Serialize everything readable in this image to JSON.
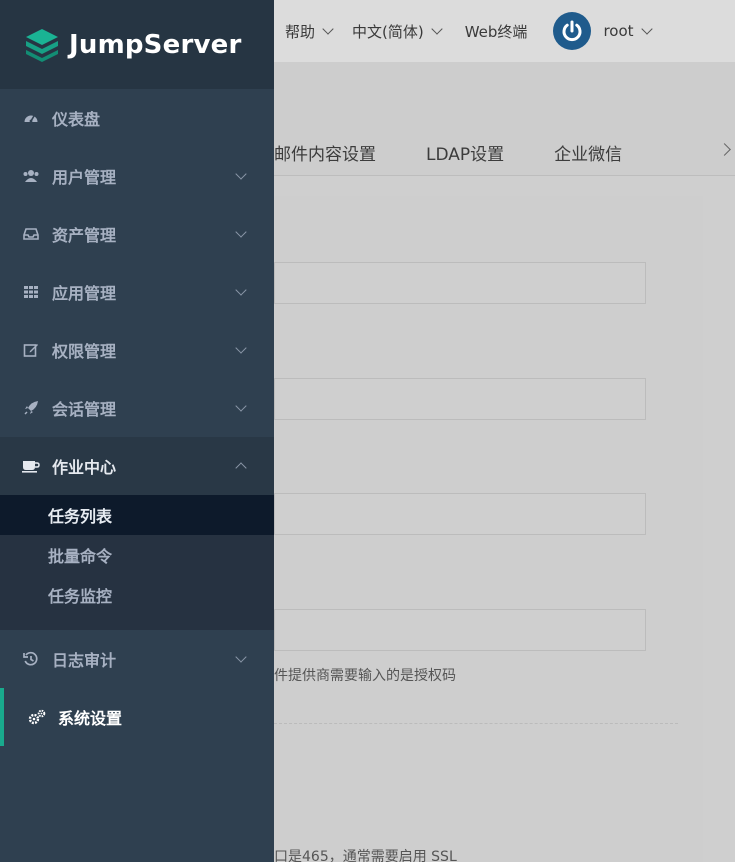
{
  "brand": {
    "name": "JumpServer"
  },
  "topbar": {
    "help": "帮助",
    "language": "中文(简体)",
    "web_terminal": "Web终端",
    "user": "root"
  },
  "tabs": [
    {
      "label": "邮件内容设置"
    },
    {
      "label": "LDAP设置"
    },
    {
      "label": "企业微信"
    }
  ],
  "content": {
    "hint_1": "件提供商需要输入的是授权码",
    "hint_2": "口是465，通常需要启用 SSL"
  },
  "sidebar": {
    "items": [
      {
        "label": "仪表盘",
        "icon": "dashboard-icon"
      },
      {
        "label": "用户管理",
        "icon": "users-icon"
      },
      {
        "label": "资产管理",
        "icon": "inbox-icon"
      },
      {
        "label": "应用管理",
        "icon": "grid-icon"
      },
      {
        "label": "权限管理",
        "icon": "edit-icon"
      },
      {
        "label": "会话管理",
        "icon": "rocket-icon"
      },
      {
        "label": "作业中心",
        "icon": "coffee-icon",
        "expanded": true,
        "children": [
          {
            "label": "任务列表",
            "active": true
          },
          {
            "label": "批量命令"
          },
          {
            "label": "任务监控"
          }
        ]
      },
      {
        "label": "日志审计",
        "icon": "history-icon"
      },
      {
        "label": "系统设置",
        "icon": "cogs-icon",
        "active": true
      }
    ]
  },
  "colors": {
    "sidebar_bg": "#2f4050",
    "accent": "#19aa8d",
    "brand_green": "#1ab394",
    "user_icon": "#1f5b8c"
  }
}
